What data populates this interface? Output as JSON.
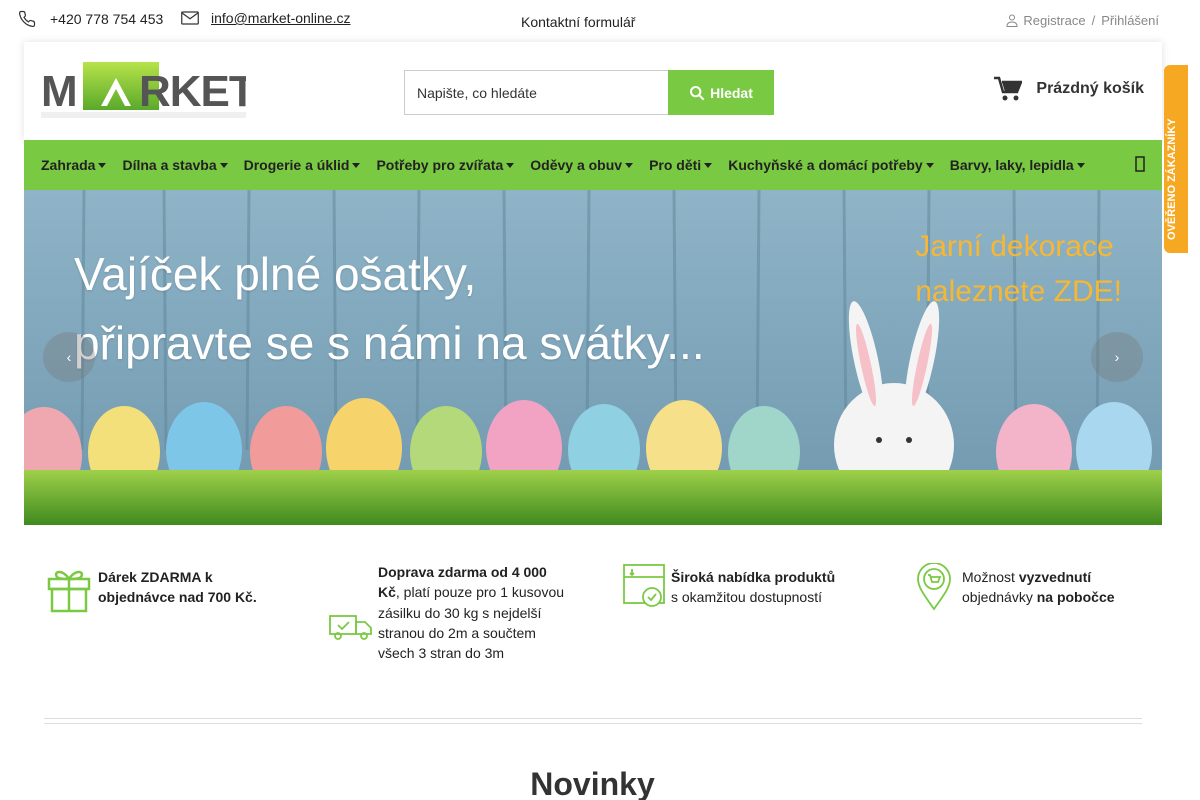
{
  "topbar": {
    "phone": "+420 778 754 453",
    "email": "info@market-online.cz",
    "contact_form": "Kontaktní formulář",
    "register": "Registrace",
    "separator": "/",
    "login": "Přihlášení"
  },
  "header": {
    "logo_text": "MARKET",
    "search_placeholder": "Napište, co hledáte",
    "search_button": "Hledat",
    "cart_label": "Prázdný košík"
  },
  "nav": {
    "items": [
      {
        "label": "Zahrada"
      },
      {
        "label": "Dílna a stavba"
      },
      {
        "label": "Drogerie a úklid"
      },
      {
        "label": "Potřeby pro zvířata"
      },
      {
        "label": "Oděvy a obuv"
      },
      {
        "label": "Pro děti"
      },
      {
        "label": "Kuchyňské a domácí potřeby"
      },
      {
        "label": "Barvy, laky, lepidla"
      }
    ]
  },
  "banner": {
    "line1": "Vajíček plné ošatky,",
    "line2": "připravte se s námi na svátky...",
    "promo1": "Jarní dekorace",
    "promo2": "naleznete ZDE!"
  },
  "side_badge": {
    "text": "OVĚŘENO ZÁKAZNÍKY"
  },
  "features": {
    "f1": {
      "line1": "Dárek ZDARMA k",
      "line2": "objednávce nad 700 Kč."
    },
    "f2": {
      "bold": "Doprava zdarma od 4 000 Kč",
      "rest": ", platí pouze pro 1 kusovou zásilku do 30 kg s nejdelší stranou do 2m a součtem všech 3 stran do 3m"
    },
    "f3": {
      "bold": "Široká nabídka produktů",
      "line2": "s okamžitou dostupností"
    },
    "f4": {
      "pre": "Možnost ",
      "bold1": "vyzvednutí",
      "mid": "objednávky ",
      "bold2": "na pobočce"
    }
  },
  "section": {
    "title": "Novinky"
  },
  "colors": {
    "accent_green": "#7ac943",
    "badge_orange": "#f7a823"
  }
}
